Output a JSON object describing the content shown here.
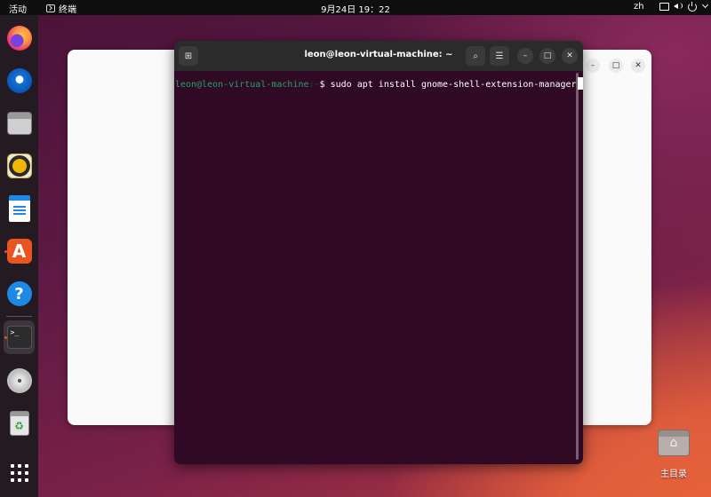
{
  "topbar": {
    "activities": "活动",
    "app_name": "终端",
    "clock": "9月24日  19：22",
    "input_method": "zh",
    "icons": [
      "network-icon",
      "volume-icon",
      "power-icon",
      "caret-down-icon"
    ]
  },
  "dock": {
    "items": [
      {
        "name": "firefox",
        "icon": "firefox-icon",
        "running": false
      },
      {
        "name": "thunderbird",
        "icon": "thunderbird-icon",
        "running": false
      },
      {
        "name": "files",
        "icon": "files-icon",
        "running": false
      },
      {
        "name": "rhythmbox",
        "icon": "rhythmbox-icon",
        "running": false
      },
      {
        "name": "libreoffice-writer",
        "icon": "writer-icon",
        "running": false
      },
      {
        "name": "ubuntu-software",
        "icon": "software-icon",
        "running": true
      },
      {
        "name": "help",
        "icon": "help-icon",
        "running": false
      },
      {
        "name": "terminal",
        "icon": "terminal-icon",
        "running": true,
        "active": true
      },
      {
        "name": "disc",
        "icon": "disc-icon",
        "running": false
      },
      {
        "name": "trash",
        "icon": "trash-icon",
        "running": false
      },
      {
        "name": "show-apps",
        "icon": "app-grid-icon",
        "running": false
      }
    ],
    "store_glyph": "A",
    "help_glyph": "?",
    "terminal_glyph": ">_",
    "trash_glyph": "♻"
  },
  "terminal": {
    "title": "leon@leon-virtual-machine: ~",
    "prompt_user": "leon@leon-virtual-machine",
    "prompt_path": ":~",
    "prompt_symbol": "$ ",
    "command": "sudo apt install gnome-shell-extension-manager"
  },
  "desktop": {
    "home_label": "主目录"
  },
  "colors": {
    "terminal_bg": "#300a24",
    "prompt_user": "#26a269",
    "accent": "#e95420"
  }
}
